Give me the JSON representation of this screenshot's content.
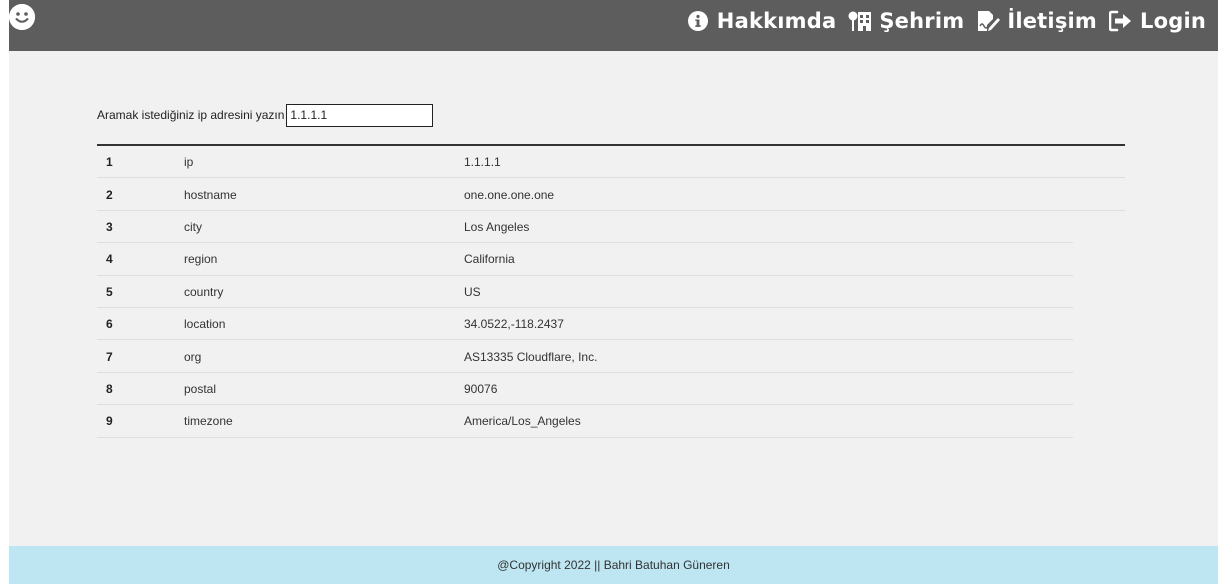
{
  "navbar": {
    "logo_icon": "smiley-face-icon",
    "items": [
      {
        "label": "Hakkımda",
        "icon": "info-circle-icon"
      },
      {
        "label": "Şehrim",
        "icon": "city-icon"
      },
      {
        "label": "İletişim",
        "icon": "signature-icon"
      },
      {
        "label": "Login",
        "icon": "sign-in-icon"
      }
    ]
  },
  "search": {
    "label": "Aramak istediğiniz ip adresini yazın",
    "value": "1.1.1.1"
  },
  "table": {
    "rows": [
      {
        "index": "1",
        "key": "ip",
        "value": "1.1.1.1"
      },
      {
        "index": "2",
        "key": "hostname",
        "value": "one.one.one.one"
      },
      {
        "index": "3",
        "key": "city",
        "value": "Los Angeles"
      },
      {
        "index": "4",
        "key": "region",
        "value": "California"
      },
      {
        "index": "5",
        "key": "country",
        "value": "US"
      },
      {
        "index": "6",
        "key": "location",
        "value": "34.0522,-118.2437"
      },
      {
        "index": "7",
        "key": "org",
        "value": "AS13335 Cloudflare, Inc."
      },
      {
        "index": "8",
        "key": "postal",
        "value": "90076"
      },
      {
        "index": "9",
        "key": "timezone",
        "value": "America/Los_Angeles"
      }
    ]
  },
  "footer": {
    "text": "@Copyright 2022 || Bahri Batuhan Güneren"
  },
  "colors": {
    "navbar_bg": "#5d5d5d",
    "page_bg": "#f1f1f1",
    "footer_bg": "#bde6f2"
  }
}
